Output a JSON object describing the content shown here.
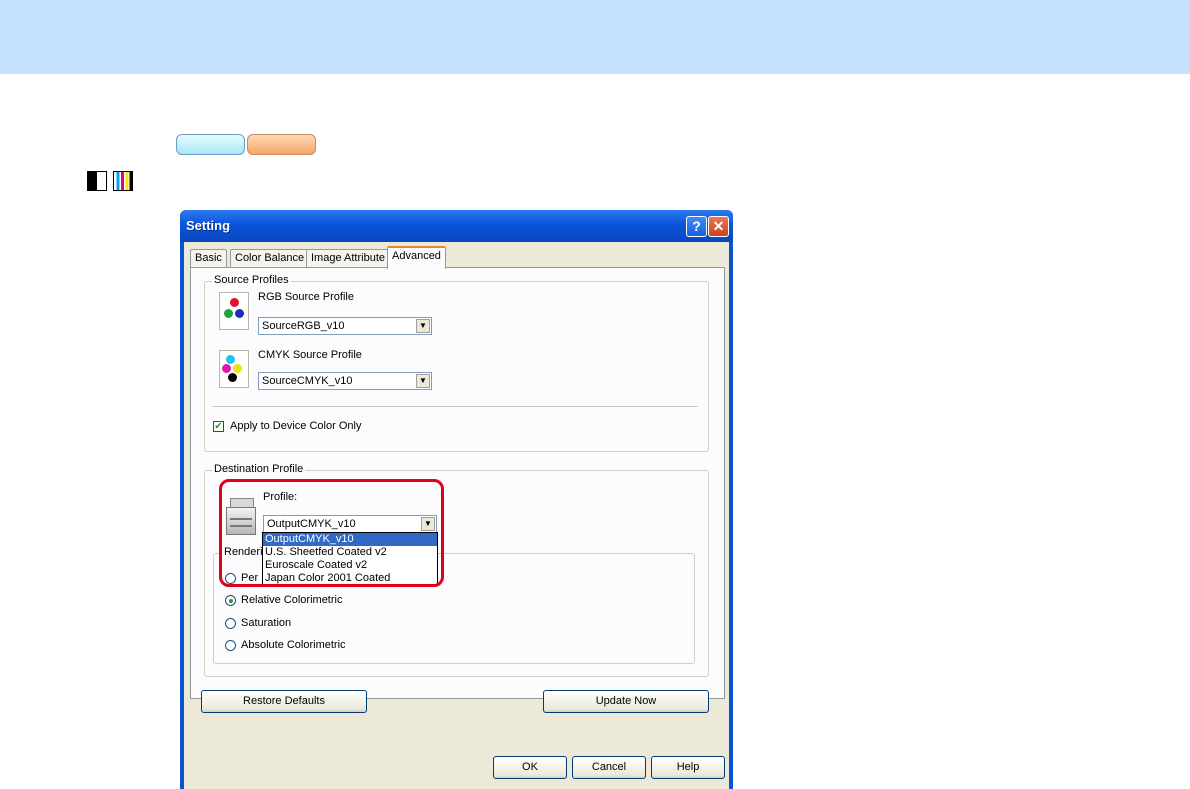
{
  "dialog": {
    "title": "Setting",
    "help_glyph": "?",
    "close_glyph": "✕"
  },
  "tabs": [
    "Basic",
    "Color Balance",
    "Image Attribute",
    "Advanced"
  ],
  "active_tab": "Advanced",
  "source_profiles": {
    "group_label": "Source Profiles",
    "rgb_label": "RGB Source Profile",
    "rgb_value": "SourceRGB_v10",
    "cmyk_label": "CMYK Source Profile",
    "cmyk_value": "SourceCMYK_v10",
    "apply_label": "Apply to Device Color Only",
    "apply_checked": true,
    "check_glyph": "✔"
  },
  "destination_profile": {
    "group_label": "Destination Profile",
    "profile_label": "Profile:",
    "profile_value": "OutputCMYK_v10",
    "options": [
      "OutputCMYK_v10",
      "U.S. Sheetfed Coated v2",
      "Euroscale Coated v2",
      "Japan Color 2001 Coated"
    ],
    "rendering_label_visible": "Renderi",
    "rendering_options": [
      "Per",
      "Relative Colorimetric",
      "Saturation",
      "Absolute Colorimetric"
    ],
    "rendering_selected": "Relative Colorimetric"
  },
  "buttons": {
    "restore_defaults": "Restore Defaults",
    "update_now": "Update Now",
    "ok": "OK",
    "cancel": "Cancel",
    "help": "Help"
  },
  "arrow_glyph": "▼",
  "colors": {
    "banner": "#c5e1fb",
    "highlight": "#e0001a",
    "selection": "#316ac5"
  }
}
